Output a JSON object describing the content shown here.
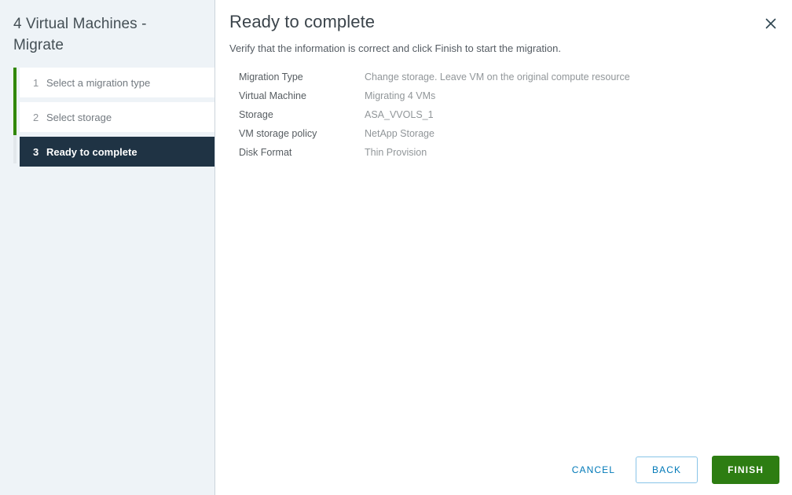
{
  "sidebar": {
    "title": "4 Virtual Machines - Migrate",
    "steps": [
      {
        "number": "1",
        "label": "Select a migration type",
        "state": "complete"
      },
      {
        "number": "2",
        "label": "Select storage",
        "state": "complete"
      },
      {
        "number": "3",
        "label": "Ready to complete",
        "state": "active"
      }
    ]
  },
  "header": {
    "title": "Ready to complete",
    "subtitle": "Verify that the information is correct and click Finish to start the migration.",
    "close_icon": "close-icon"
  },
  "details": [
    {
      "label": "Migration Type",
      "value": "Change storage. Leave VM on the original compute resource"
    },
    {
      "label": "Virtual Machine",
      "value": "Migrating 4 VMs"
    },
    {
      "label": "Storage",
      "value": "ASA_VVOLS_1"
    },
    {
      "label": "VM storage policy",
      "value": "NetApp Storage"
    },
    {
      "label": "Disk Format",
      "value": "Thin Provision"
    }
  ],
  "footer": {
    "cancel_label": "CANCEL",
    "back_label": "BACK",
    "finish_label": "FINISH"
  },
  "colors": {
    "sidebar_bg": "#eef3f7",
    "active_step_bg": "#1f3344",
    "progress_green": "#318700",
    "primary_green": "#2d7d12",
    "link_blue": "#0079b8",
    "outline_blue": "#89c4e8"
  }
}
